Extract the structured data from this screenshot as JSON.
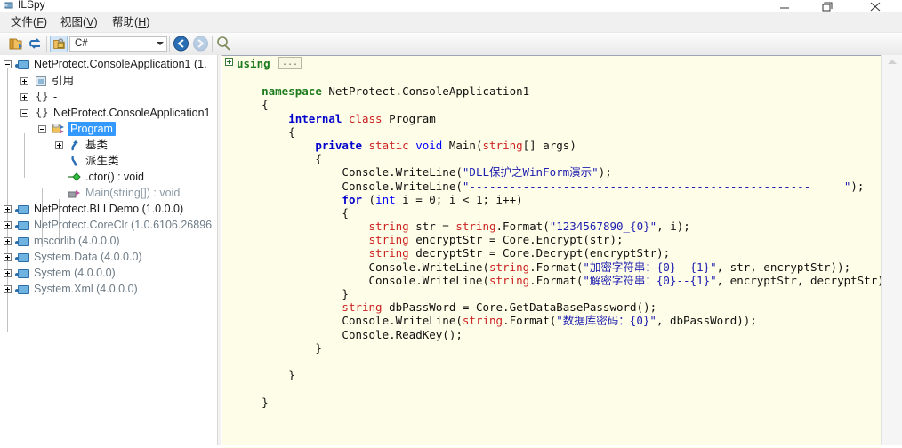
{
  "window": {
    "title": "ILSpy",
    "app_icon": "ilspy-icon",
    "controls": {
      "minimize": "minimize-icon",
      "maximize": "restore-icon",
      "close": "close-icon"
    }
  },
  "menubar": {
    "items": [
      {
        "name": "file",
        "label": "文件",
        "mnemonic": "F"
      },
      {
        "name": "view",
        "label": "视图",
        "mnemonic": "V"
      },
      {
        "name": "help",
        "label": "帮助",
        "mnemonic": "H"
      }
    ]
  },
  "toolbar": {
    "buttons": [
      {
        "name": "open-assembly",
        "icon": "open-folder-icon",
        "active": false
      },
      {
        "name": "reload-assembly",
        "icon": "refresh-icon",
        "active": false
      },
      {
        "name": "decompile-lock",
        "icon": "lock-icon",
        "active": true
      },
      {
        "name": "back",
        "icon": "back-arrow-icon",
        "active": false
      },
      {
        "name": "forward",
        "icon": "forward-arrow-icon",
        "active": false
      },
      {
        "name": "search",
        "icon": "search-icon",
        "active": false
      }
    ],
    "language_combo": {
      "value": "C#",
      "arrow": "chevron-down-icon"
    }
  },
  "tree": {
    "nodes": [
      {
        "label": "NetProtect.ConsoleApplication1 (1.",
        "icon": "assembly-icon",
        "indent": 0,
        "expander": "minus",
        "color": "black",
        "selected": false
      },
      {
        "label": "引用",
        "icon": "references-icon",
        "indent": 1,
        "expander": "plus",
        "color": "black",
        "selected": false
      },
      {
        "label": "-",
        "icon": "namespace-icon",
        "indent": 1,
        "expander": "plus",
        "color": "black",
        "selected": false
      },
      {
        "label": "NetProtect.ConsoleApplication1",
        "icon": "namespace-icon",
        "indent": 1,
        "expander": "minus",
        "color": "black",
        "selected": false
      },
      {
        "label": "Program",
        "icon": "class-icon",
        "indent": 2,
        "expander": "minus",
        "color": "black",
        "selected": true
      },
      {
        "label": "基类",
        "icon": "base-types-icon",
        "indent": 3,
        "expander": "plus",
        "color": "black",
        "selected": false
      },
      {
        "label": "派生类",
        "icon": "derived-types-icon",
        "indent": 3,
        "expander": "none",
        "color": "black",
        "selected": false
      },
      {
        "label": ".ctor() : void",
        "icon": "constructor-icon",
        "indent": 3,
        "expander": "none",
        "color": "black",
        "selected": false
      },
      {
        "label": "Main(string[]) : void",
        "icon": "method-icon",
        "indent": 3,
        "expander": "none",
        "color": "gray",
        "selected": false
      },
      {
        "label": "NetProtect.BLLDemo (1.0.0.0)",
        "icon": "assembly-icon",
        "indent": 0,
        "expander": "plus",
        "color": "black",
        "selected": false
      },
      {
        "label": "NetProtect.CoreClr (1.0.6106.26896",
        "icon": "assembly-icon",
        "indent": 0,
        "expander": "plus",
        "color": "gray",
        "selected": false
      },
      {
        "label": "mscorlib (4.0.0.0)",
        "icon": "assembly-icon",
        "indent": 0,
        "expander": "plus",
        "color": "gray",
        "selected": false
      },
      {
        "label": "System.Data (4.0.0.0)",
        "icon": "assembly-icon",
        "indent": 0,
        "expander": "plus",
        "color": "gray",
        "selected": false
      },
      {
        "label": "System (4.0.0.0)",
        "icon": "assembly-icon",
        "indent": 0,
        "expander": "plus",
        "color": "gray",
        "selected": false
      },
      {
        "label": "System.Xml (4.0.0.0)",
        "icon": "assembly-icon",
        "indent": 0,
        "expander": "plus",
        "color": "gray",
        "selected": false
      }
    ]
  },
  "code": {
    "fold_marker": "minus",
    "fold_keyword": "using",
    "fold_ellipsis": "...",
    "background_color": "#fefee8",
    "lines": [
      {
        "indent": 0,
        "tokens": []
      },
      {
        "indent": 1,
        "tokens": [
          {
            "t": "namespace ",
            "c": "ns"
          },
          {
            "t": "NetProtect.ConsoleApplication1",
            "c": "plain"
          }
        ]
      },
      {
        "indent": 1,
        "tokens": [
          {
            "t": "{",
            "c": "plain"
          }
        ]
      },
      {
        "indent": 2,
        "tokens": [
          {
            "t": "internal ",
            "c": "kw"
          },
          {
            "t": "class ",
            "c": "type2"
          },
          {
            "t": "Program",
            "c": "plain"
          }
        ]
      },
      {
        "indent": 2,
        "tokens": [
          {
            "t": "{",
            "c": "plain"
          }
        ]
      },
      {
        "indent": 3,
        "tokens": [
          {
            "t": "private ",
            "c": "kw"
          },
          {
            "t": "static ",
            "c": "type2"
          },
          {
            "t": "void ",
            "c": "kw2"
          },
          {
            "t": "Main(",
            "c": "plain"
          },
          {
            "t": "string",
            "c": "type2"
          },
          {
            "t": "[] args)",
            "c": "plain"
          }
        ]
      },
      {
        "indent": 3,
        "tokens": [
          {
            "t": "{",
            "c": "plain"
          }
        ]
      },
      {
        "indent": 4,
        "tokens": [
          {
            "t": "Console.WriteLine(",
            "c": "plain"
          },
          {
            "t": "\"DLL保护之WinForm演示\"",
            "c": "str"
          },
          {
            "t": ");",
            "c": "plain"
          }
        ]
      },
      {
        "indent": 4,
        "tokens": [
          {
            "t": "Console.WriteLine(",
            "c": "plain"
          },
          {
            "t": "\"---------------------------------------------------     \"",
            "c": "str"
          },
          {
            "t": ");",
            "c": "plain"
          }
        ]
      },
      {
        "indent": 4,
        "tokens": [
          {
            "t": "for ",
            "c": "kw"
          },
          {
            "t": "(",
            "c": "plain"
          },
          {
            "t": "int ",
            "c": "kw2"
          },
          {
            "t": "i = 0; i < 1; i++)",
            "c": "plain"
          }
        ]
      },
      {
        "indent": 4,
        "tokens": [
          {
            "t": "{",
            "c": "plain"
          }
        ]
      },
      {
        "indent": 5,
        "tokens": [
          {
            "t": "string ",
            "c": "type2"
          },
          {
            "t": "str = ",
            "c": "plain"
          },
          {
            "t": "string",
            "c": "type2"
          },
          {
            "t": ".Format(",
            "c": "plain"
          },
          {
            "t": "\"1234567890_{0}\"",
            "c": "str"
          },
          {
            "t": ", i);",
            "c": "plain"
          }
        ]
      },
      {
        "indent": 5,
        "tokens": [
          {
            "t": "string ",
            "c": "type2"
          },
          {
            "t": "encryptStr = Core.Encrypt(str);",
            "c": "plain"
          }
        ]
      },
      {
        "indent": 5,
        "tokens": [
          {
            "t": "string ",
            "c": "type2"
          },
          {
            "t": "decryptStr = Core.Decrypt(encryptStr);",
            "c": "plain"
          }
        ]
      },
      {
        "indent": 5,
        "tokens": [
          {
            "t": "Console.WriteLine(",
            "c": "plain"
          },
          {
            "t": "string",
            "c": "type2"
          },
          {
            "t": ".Format(",
            "c": "plain"
          },
          {
            "t": "\"加密字符串：{0}--{1}\"",
            "c": "str"
          },
          {
            "t": ", str, encryptStr));",
            "c": "plain"
          }
        ]
      },
      {
        "indent": 5,
        "tokens": [
          {
            "t": "Console.WriteLine(",
            "c": "plain"
          },
          {
            "t": "string",
            "c": "type2"
          },
          {
            "t": ".Format(",
            "c": "plain"
          },
          {
            "t": "\"解密字符串：{0}--{1}\"",
            "c": "str"
          },
          {
            "t": ", encryptStr, decryptStr));",
            "c": "plain"
          }
        ]
      },
      {
        "indent": 4,
        "tokens": [
          {
            "t": "}",
            "c": "plain"
          }
        ]
      },
      {
        "indent": 4,
        "tokens": [
          {
            "t": "string ",
            "c": "type2"
          },
          {
            "t": "dbPassWord = Core.GetDataBasePassword();",
            "c": "plain"
          }
        ]
      },
      {
        "indent": 4,
        "tokens": [
          {
            "t": "Console.WriteLine(",
            "c": "plain"
          },
          {
            "t": "string",
            "c": "type2"
          },
          {
            "t": ".Format(",
            "c": "plain"
          },
          {
            "t": "\"数据库密码：{0}\"",
            "c": "str"
          },
          {
            "t": ", dbPassWord));",
            "c": "plain"
          }
        ]
      },
      {
        "indent": 4,
        "tokens": [
          {
            "t": "Console.ReadKey();",
            "c": "plain"
          }
        ]
      },
      {
        "indent": 3,
        "tokens": [
          {
            "t": "}",
            "c": "plain"
          }
        ]
      },
      {
        "indent": 0,
        "tokens": []
      },
      {
        "indent": 2,
        "tokens": [
          {
            "t": "}",
            "c": "plain"
          }
        ]
      },
      {
        "indent": 0,
        "tokens": []
      },
      {
        "indent": 1,
        "tokens": [
          {
            "t": "}",
            "c": "plain"
          }
        ]
      }
    ]
  },
  "scrollbar": {
    "name": "code-vertical-scrollbar"
  }
}
